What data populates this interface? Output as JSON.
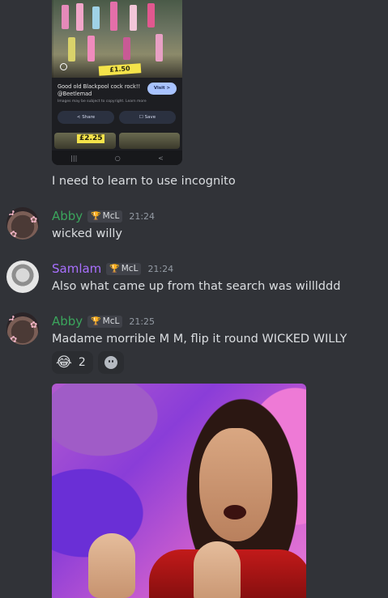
{
  "embedded_screenshot": {
    "price_label": "£1.50",
    "title": "Good old Blackpool cock rock!!\n@Beetlemad",
    "note": "Images may be subject to copyright. Learn more",
    "visit_label": "Visit >",
    "share_label": "< Share",
    "save_label": "☐ Save",
    "thumb_price": "£2.25",
    "nav": [
      "|||",
      "○",
      "<"
    ]
  },
  "messages": [
    {
      "id": "m0",
      "text": "I need to learn to use incognito"
    },
    {
      "id": "m1",
      "author": "Abby",
      "author_color": "#3ba55c",
      "tag": "McL",
      "time": "21:24",
      "text": "wicked willy"
    },
    {
      "id": "m2",
      "author": "Samlam",
      "author_color": "#a970ff",
      "tag": "McL",
      "time": "21:24",
      "text": "Also what came up from that search was willlddd"
    },
    {
      "id": "m3",
      "author": "Abby",
      "author_color": "#3ba55c",
      "tag": "McL",
      "time": "21:25",
      "text": "Madame morrible M M, flip it round WICKED WILLY"
    }
  ],
  "reactions": [
    {
      "emoji": "😂",
      "count": "2"
    }
  ],
  "icons": {
    "trophy": "trophy-icon",
    "add_reaction": "smile-icon",
    "lens": "lens-icon"
  }
}
